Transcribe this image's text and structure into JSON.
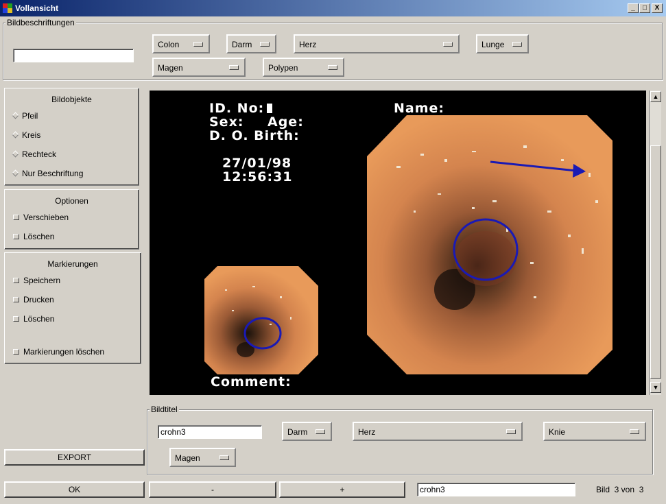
{
  "window": {
    "title": "Vollansicht",
    "controls": [
      "_",
      "□",
      "X"
    ]
  },
  "top_group": {
    "legend": "Bildbeschriftungen",
    "input_value": "",
    "menus": [
      "Colon",
      "Darm",
      "Herz",
      "Lunge",
      "Magen",
      "Polypen"
    ]
  },
  "bildobjekte": {
    "title": "Bildobjekte",
    "items": [
      "Pfeil",
      "Kreis",
      "Rechteck",
      "Nur Beschriftung"
    ]
  },
  "optionen": {
    "title": "Optionen",
    "items": [
      "Verschieben",
      "Löschen"
    ]
  },
  "markierungen": {
    "title": "Markierungen",
    "items": [
      "Speichern",
      "Drucken",
      "Löschen",
      "Markierungen löschen"
    ]
  },
  "viewer": {
    "id_label": "ID. No:",
    "sex_label": "Sex:",
    "age_label": "Age:",
    "dob_label": "D. O. Birth:",
    "date": "27/01/98",
    "time": "12:56:31",
    "name_label": "Name:",
    "comment_label": "Comment:"
  },
  "bildtitel": {
    "legend": "Bildtitel",
    "input_value": "crohn3",
    "menus": [
      "Darm",
      "Herz",
      "Knie",
      "Magen"
    ]
  },
  "buttons": {
    "export": "EXPORT",
    "ok": "OK",
    "prev": "-",
    "next": "+"
  },
  "footer": {
    "filename_value": "crohn3",
    "status": "Bild  3 von  3"
  },
  "colors": {
    "titlebar_start": "#0a246a",
    "titlebar_end": "#a6caf0",
    "annotation": "#1a1ab4",
    "window_bg": "#d4d0c8"
  },
  "icons": [
    "app-icon",
    "diamond-radio-icon",
    "square-toggle-icon",
    "scroll-up-icon",
    "scroll-down-icon",
    "option-menu-indicator-icon"
  ]
}
